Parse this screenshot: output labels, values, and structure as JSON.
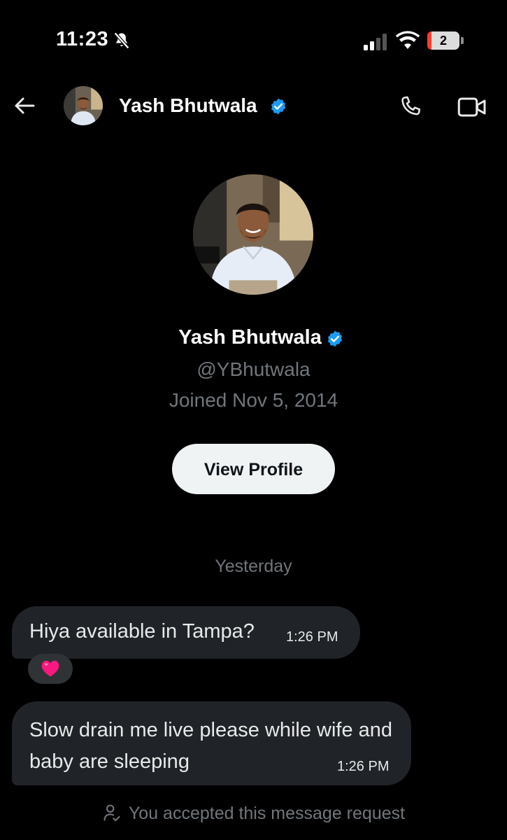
{
  "status_bar": {
    "time": "11:23",
    "battery_level": "2",
    "icons": [
      "bell-off-icon",
      "signal-icon",
      "wifi-icon",
      "battery-icon"
    ]
  },
  "header": {
    "name": "Yash Bhutwala",
    "verified": true,
    "icons": [
      "back-arrow-icon",
      "avatar",
      "verified-badge-icon",
      "phone-icon",
      "video-camera-icon"
    ]
  },
  "profile": {
    "name": "Yash Bhutwala",
    "handle": "@YBhutwala",
    "joined": "Joined Nov 5, 2014",
    "view_profile_label": "View Profile"
  },
  "conversation": {
    "date_separator": "Yesterday",
    "messages": [
      {
        "text": "Hiya available in Tampa?",
        "time": "1:26 PM",
        "reaction": "heart-icon"
      },
      {
        "text": "Slow drain me live please while wife and baby are sleeping",
        "time": "1:26 PM"
      }
    ],
    "accepted_note": "You accepted this message request"
  },
  "colors": {
    "background": "#000000",
    "bubble": "#202327",
    "muted_text": "#71767b",
    "verified_blue": "#1d9bf0",
    "button_bg": "#eff3f4",
    "heart": "#f91880"
  }
}
